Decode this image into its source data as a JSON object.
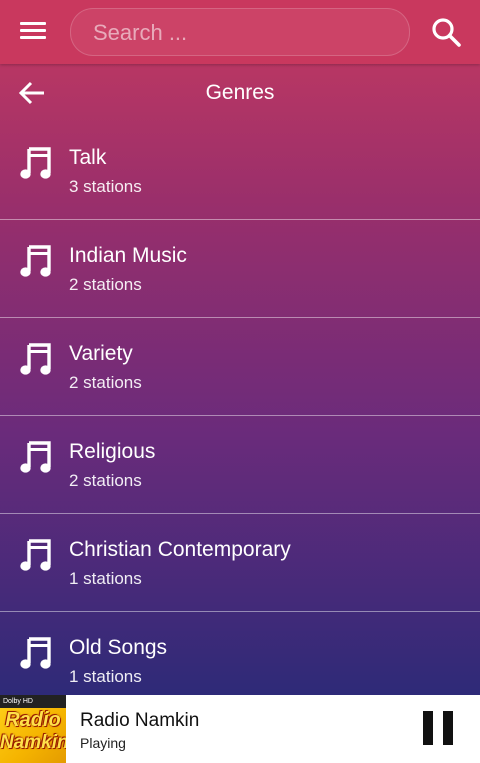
{
  "search": {
    "placeholder": "Search ..."
  },
  "header": {
    "title": "Genres"
  },
  "genres": [
    {
      "name": "Talk",
      "count": "3 stations"
    },
    {
      "name": "Indian Music",
      "count": "2 stations"
    },
    {
      "name": "Variety",
      "count": "2 stations"
    },
    {
      "name": "Religious",
      "count": "2 stations"
    },
    {
      "name": "Christian Contemporary",
      "count": "1 stations"
    },
    {
      "name": "Old Songs",
      "count": "1 stations"
    }
  ],
  "player": {
    "station": "Radio Namkin",
    "status": "Playing",
    "logo": {
      "badge": "Dolby HD",
      "line1": "Radio",
      "line2": "Namkin"
    }
  },
  "icons": {
    "menu": "hamburger-menu-icon",
    "search": "search-icon",
    "back": "arrow-left-icon",
    "genre": "music-note-icon",
    "pause": "pause-icon"
  },
  "colors": {
    "topbar": "#c9385e",
    "gradient_top": "#c63a60",
    "gradient_bottom": "#2e2a78",
    "player_bg": "#ffffff"
  }
}
